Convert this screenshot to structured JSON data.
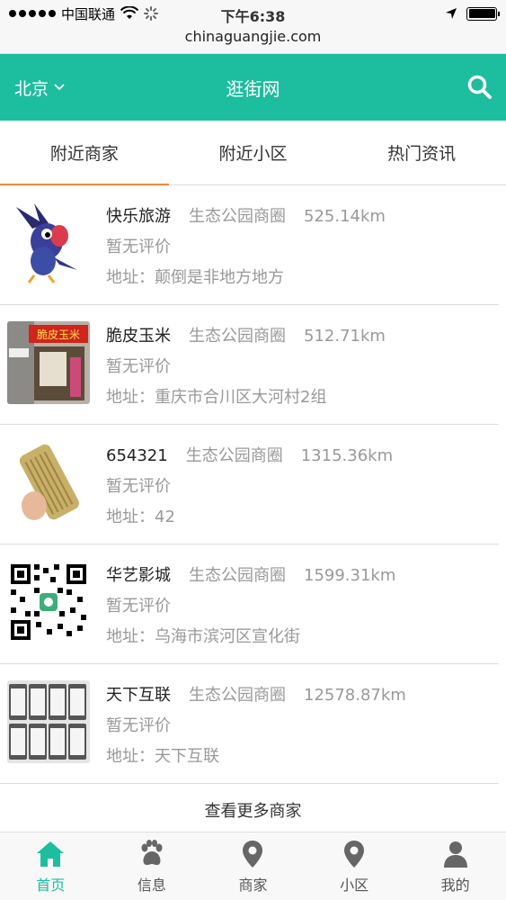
{
  "status_bar": {
    "carrier": "中国联通",
    "time": "下午6:38",
    "url": "chinaguangjie.com"
  },
  "header": {
    "city": "北京",
    "title": "逛街网",
    "accent_color": "#1dbd9f"
  },
  "tabs": [
    {
      "label": "附近商家",
      "active": true
    },
    {
      "label": "附近小区",
      "active": false
    },
    {
      "label": "热门资讯",
      "active": false
    }
  ],
  "merchants": [
    {
      "name": "快乐旅游",
      "area": "生态公园商圈",
      "distance": "525.14km",
      "rating": "暂无评价",
      "address": "地址：颠倒是非地方地方"
    },
    {
      "name": "脆皮玉米",
      "area": "生态公园商圈",
      "distance": "512.71km",
      "rating": "暂无评价",
      "address": "地址：重庆市合川区大河村2组",
      "sign_text": "脆皮玉米"
    },
    {
      "name": "654321",
      "area": "生态公园商圈",
      "distance": "1315.36km",
      "rating": "暂无评价",
      "address": "地址：42"
    },
    {
      "name": "华艺影城",
      "area": "生态公园商圈",
      "distance": "1599.31km",
      "rating": "暂无评价",
      "address": "地址：乌海市滨河区宣化街"
    },
    {
      "name": "天下互联",
      "area": "生态公园商圈",
      "distance": "12578.87km",
      "rating": "暂无评价",
      "address": "地址：天下互联"
    }
  ],
  "more_label": "查看更多商家",
  "bottom_nav": [
    {
      "label": "首页",
      "icon": "home-icon",
      "active": true
    },
    {
      "label": "信息",
      "icon": "paw-icon",
      "active": false
    },
    {
      "label": "商家",
      "icon": "location-pin-icon",
      "active": false
    },
    {
      "label": "小区",
      "icon": "location-pin-icon",
      "active": false
    },
    {
      "label": "我的",
      "icon": "user-icon",
      "active": false
    }
  ]
}
